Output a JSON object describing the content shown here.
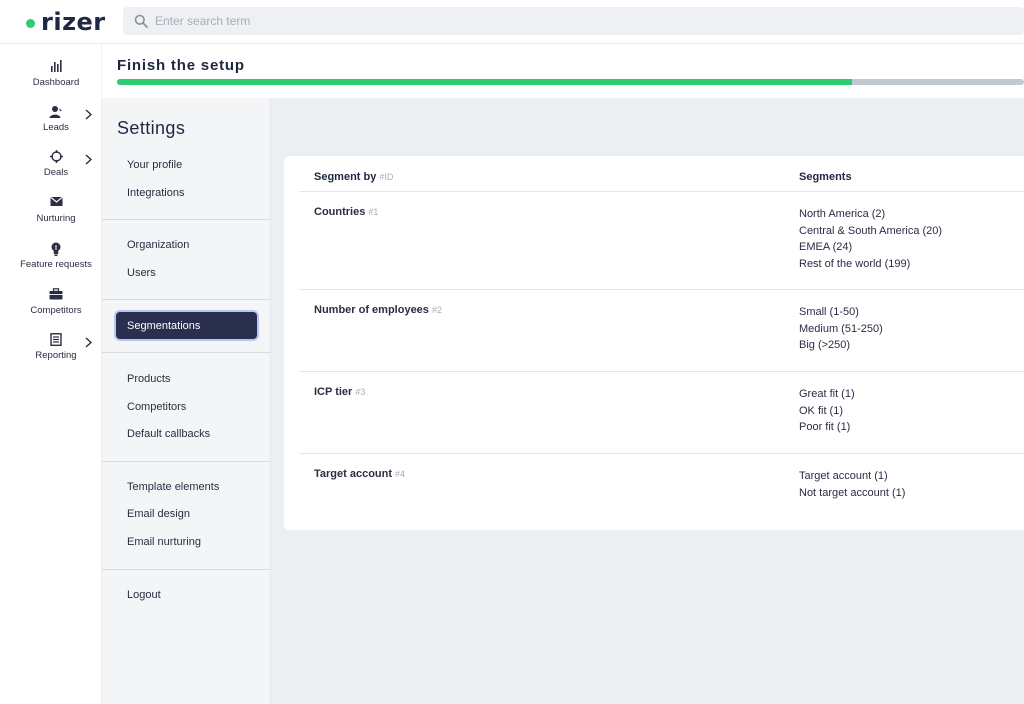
{
  "app": {
    "logo_text": "rizer",
    "brand_color": "#2ecc71",
    "accent_dark": "#2a2f4d"
  },
  "search": {
    "placeholder": "Enter search term"
  },
  "nav": {
    "items": [
      {
        "label": "Dashboard",
        "icon": "bar-chart-icon",
        "has_chevron": false
      },
      {
        "label": "Leads",
        "icon": "user-icon",
        "has_chevron": true
      },
      {
        "label": "Deals",
        "icon": "target-icon",
        "has_chevron": true
      },
      {
        "label": "Nurturing",
        "icon": "envelope-icon",
        "has_chevron": false
      },
      {
        "label": "Feature requests",
        "icon": "lightbulb-icon",
        "has_chevron": false
      },
      {
        "label": "Competitors",
        "icon": "briefcase-icon",
        "has_chevron": false
      },
      {
        "label": "Reporting",
        "icon": "report-icon",
        "has_chevron": true
      }
    ]
  },
  "setup": {
    "title": "Finish the setup",
    "progress_fraction": 0.81
  },
  "settings": {
    "title": "Settings",
    "items": [
      "Your profile",
      "Integrations",
      "Organization",
      "Users",
      "Segmentations",
      "Products",
      "Competitors",
      "Default callbacks",
      "Template elements",
      "Email design",
      "Email nurturing",
      "Logout"
    ],
    "active": "Segmentations"
  },
  "table": {
    "col_segment_by": "Segment by",
    "col_id_hint": "#ID",
    "col_segments": "Segments",
    "rows": [
      {
        "name": "Countries",
        "id": "#1",
        "segments": [
          "North America (2)",
          "Central & South America (20)",
          "EMEA (24)",
          "Rest of the world (199)"
        ]
      },
      {
        "name": "Number of employees",
        "id": "#2",
        "segments": [
          "Small (1-50)",
          "Medium (51-250)",
          "Big (>250)"
        ]
      },
      {
        "name": "ICP tier",
        "id": "#3",
        "segments": [
          "Great fit (1)",
          "OK fit (1)",
          "Poor fit (1)"
        ]
      },
      {
        "name": "Target account",
        "id": "#4",
        "segments": [
          "Target account (1)",
          "Not target account (1)"
        ]
      }
    ]
  }
}
